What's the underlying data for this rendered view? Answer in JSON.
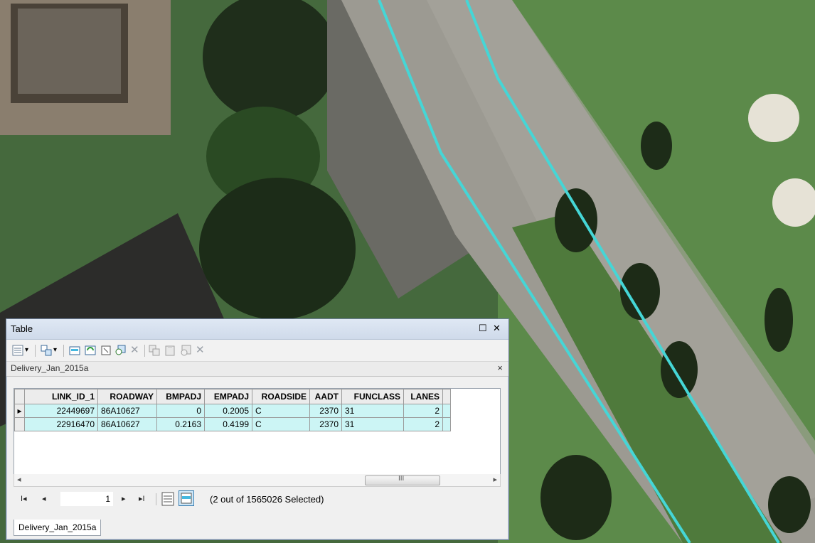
{
  "window": {
    "title": "Table",
    "maximize_glyph": "☐",
    "close_glyph": "✕"
  },
  "toolbar": {
    "icons": [
      "table-options-icon",
      "related-tables-icon",
      "select-by-attributes-icon",
      "switch-selection-icon",
      "clear-selection-icon",
      "zoom-to-selected-icon",
      "delete-selected-icon",
      "copy-selected-icon",
      "paste-icon",
      "add-field-icon",
      "delete-field-icon"
    ]
  },
  "layer_tab": {
    "name": "Delivery_Jan_2015a",
    "close_glyph": "×"
  },
  "table": {
    "columns": [
      "LINK_ID_1",
      "ROADWAY",
      "BMPADJ",
      "EMPADJ",
      "ROADSIDE",
      "AADT",
      "FUNCLASS",
      "LANES",
      ""
    ],
    "rows": [
      {
        "current": true,
        "cells": [
          "22449697",
          "86A10627",
          "0",
          "0.2005",
          "C",
          "2370",
          "31",
          "2"
        ]
      },
      {
        "current": false,
        "cells": [
          "22916470",
          "86A10627",
          "0.2163",
          "0.4199",
          "C",
          "2370",
          "31",
          "2"
        ]
      }
    ],
    "row_marker": "▸"
  },
  "scrollbar": {
    "left_glyph": "◂",
    "right_glyph": "▸",
    "grip": "III"
  },
  "navigation": {
    "first_glyph": "I◂",
    "prev_glyph": "◂",
    "record": "1",
    "next_glyph": "▸",
    "last_glyph": "▸I",
    "selection_status": "(2 out of 1565026 Selected)"
  },
  "bottom_tab": {
    "label": "Delivery_Jan_2015a"
  },
  "colors": {
    "road_line": "#45d6d6",
    "selected_row": "#ccf5f5"
  }
}
